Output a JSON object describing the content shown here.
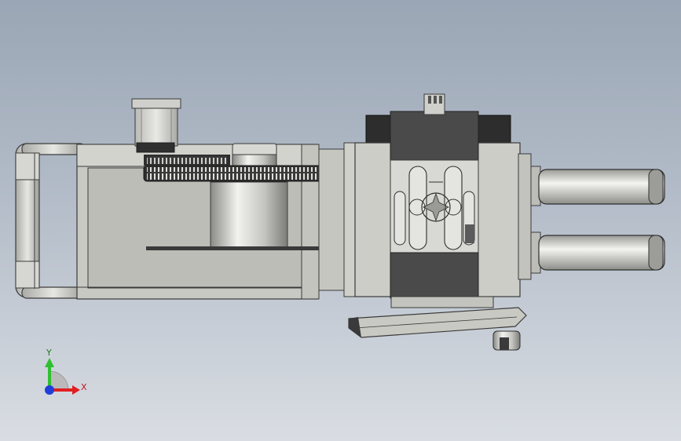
{
  "viewport": {
    "background_top": "#9aa6b5",
    "background_bottom": "#d9dde3"
  },
  "model": {
    "base_frame_color": "#c9c9c4",
    "panel_color": "#b8b8b3",
    "housing_dark_color": "#4a4a4a",
    "gear_color": "#2e2e2e",
    "cylinder_color": "#d0d0cc"
  },
  "triad": {
    "x_label": "X",
    "y_label": "Y",
    "x_color": "#e02020",
    "y_color": "#2fbf2f",
    "z_color": "#1f3fd8"
  }
}
